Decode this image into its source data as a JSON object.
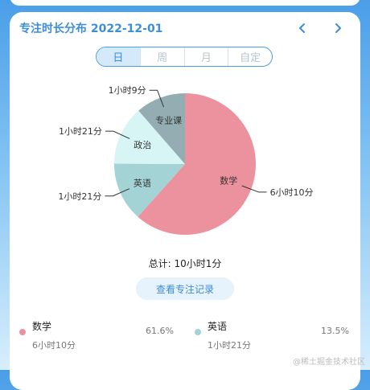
{
  "header": {
    "title": "专注时长分布 2022-12-01",
    "prev_icon": "chevron-left-icon",
    "next_icon": "chevron-right-icon",
    "accent": "#3c8ed8"
  },
  "tabs": [
    {
      "label": "日",
      "active": true
    },
    {
      "label": "周",
      "active": false
    },
    {
      "label": "月",
      "active": false
    },
    {
      "label": "自定",
      "active": false
    }
  ],
  "chart_data": {
    "type": "pie",
    "series": [
      {
        "name": "数学",
        "duration": "6小时10分",
        "value": 61.6,
        "color": "#ec929f"
      },
      {
        "name": "英语",
        "duration": "1小时21分",
        "value": 13.5,
        "color": "#a3d3d5"
      },
      {
        "name": "政治",
        "duration": "1小时21分",
        "value": 13.5,
        "color": "#d7f5f5"
      },
      {
        "name": "专业课",
        "duration": "1小时9分",
        "value": 11.4,
        "color": "#93adb3"
      }
    ]
  },
  "summary": {
    "total_label": "总计: 10小时1分"
  },
  "record_button": {
    "label": "查看专注记录"
  },
  "legend": [
    {
      "name": "数学",
      "duration": "6小时10分",
      "percent": "61.6%",
      "color": "#ec929f"
    },
    {
      "name": "英语",
      "duration": "1小时21分",
      "percent": "13.5%",
      "color": "#a3d3d5"
    }
  ],
  "watermark": "@稀土掘金技术社区"
}
